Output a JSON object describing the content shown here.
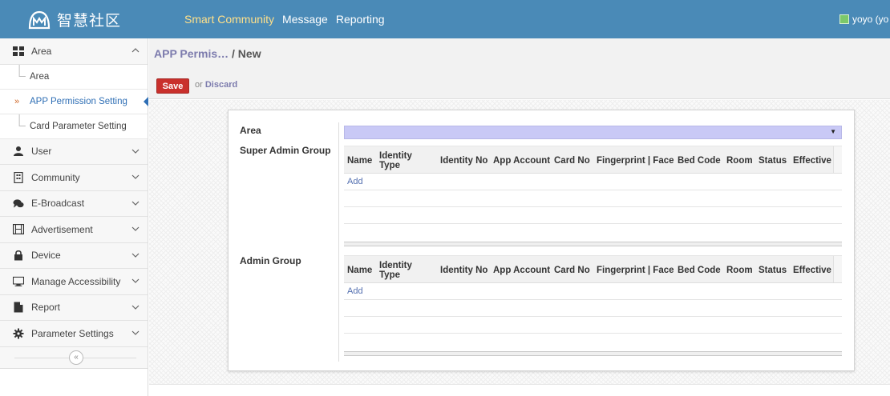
{
  "brand": {
    "title": "智慧社区"
  },
  "topnav": [
    {
      "label": "Smart Community",
      "active": true
    },
    {
      "label": "Message",
      "active": false
    },
    {
      "label": "Reporting",
      "active": false
    }
  ],
  "user": {
    "name": "yoyo (yo"
  },
  "sidebar": {
    "area": {
      "label": "Area",
      "icon": "grid-icon",
      "subitems": [
        {
          "label": "Area",
          "active": false
        },
        {
          "label": "APP Permission Setting",
          "active": true
        },
        {
          "label": "Card Parameter Setting",
          "active": false
        }
      ]
    },
    "items": [
      {
        "label": "User",
        "icon": "user-icon"
      },
      {
        "label": "Community",
        "icon": "building-icon"
      },
      {
        "label": "E-Broadcast",
        "icon": "chat-icon"
      },
      {
        "label": "Advertisement",
        "icon": "film-icon"
      },
      {
        "label": "Device",
        "icon": "lock-icon"
      },
      {
        "label": "Manage Accessibility",
        "icon": "monitor-icon"
      },
      {
        "label": "Report",
        "icon": "document-icon"
      },
      {
        "label": "Parameter Settings",
        "icon": "gear-icon"
      }
    ],
    "collapse_label": "«"
  },
  "breadcrumb": {
    "parent": "APP Permis…",
    "sep": " / ",
    "current": "New"
  },
  "actions": {
    "save": "Save",
    "or": "or",
    "discard": "Discard"
  },
  "form": {
    "area_label": "Area",
    "super_admin_label": "Super Admin Group",
    "admin_label": "Admin Group",
    "columns": [
      "Name",
      "Identity Type",
      "Identity No",
      "App Account",
      "Card No",
      "Fingerprint | Face",
      "Bed Code",
      "Room",
      "Status",
      "Effective"
    ],
    "add_label": "Add"
  },
  "colors": {
    "topbar": "#4a8ab7",
    "active_nav": "#ffe08a",
    "save_button": "#c9302c",
    "select_fill": "#c9c9f6",
    "link": "#7c7bad"
  }
}
